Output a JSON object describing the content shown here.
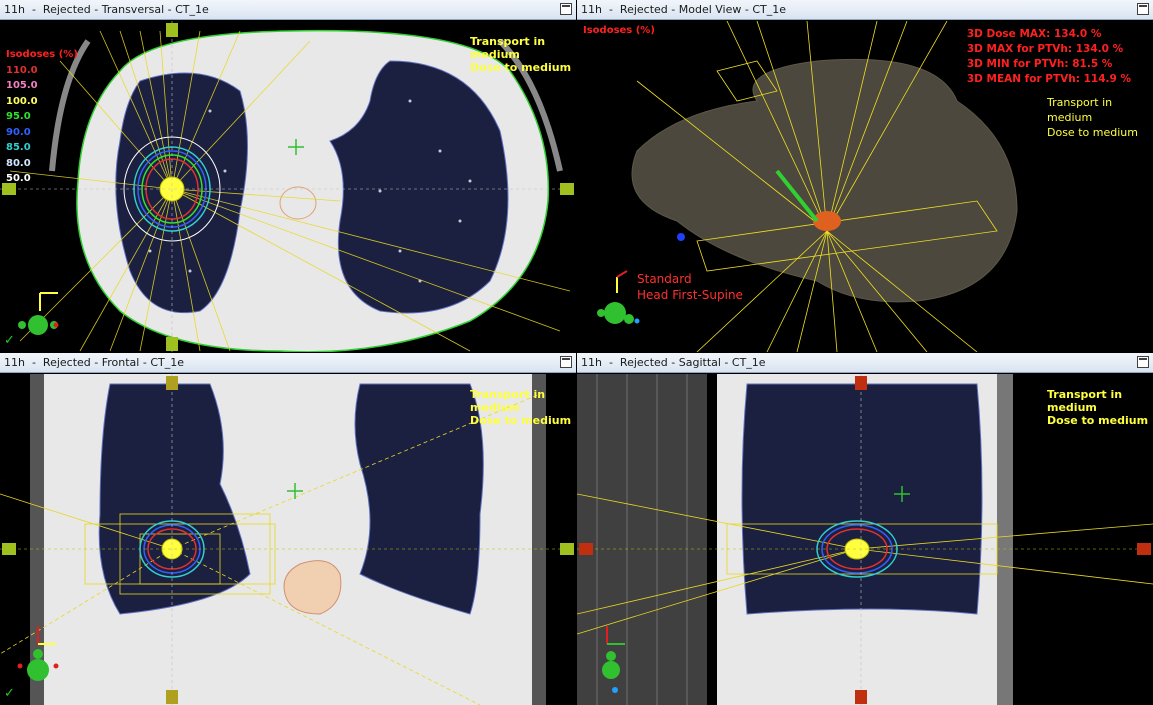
{
  "panes": {
    "transversal": {
      "title": "11h  -  Rejected - Transversal - CT_1e",
      "transport_note": [
        "Transport in",
        "medium",
        "Dose to medium"
      ]
    },
    "model": {
      "title": "11h  -  Rejected - Model View - CT_1e",
      "isodoses_title": "Isodoses (%)",
      "stats": [
        "3D Dose MAX: 134.0 %",
        "3D MAX for PTVh: 134.0 %",
        "3D MIN for PTVh: 81.5 %",
        "3D MEAN for PTVh: 114.9 %"
      ],
      "transport_note": [
        "Transport in",
        "medium",
        "Dose to medium"
      ],
      "orientation": [
        "Standard",
        "Head First-Supine"
      ]
    },
    "frontal": {
      "title": "11h  -  Rejected - Frontal - CT_1e",
      "transport_note": [
        "Transport in",
        "medium",
        "Dose to medium"
      ]
    },
    "sagittal": {
      "title": "11h  -  Rejected - Sagittal - CT_1e",
      "transport_note": [
        "Transport in",
        "medium",
        "Dose to medium"
      ]
    }
  },
  "isodoses": {
    "title": "Isodoses (%)",
    "levels": [
      {
        "value": "110.0",
        "color": "#e03030"
      },
      {
        "value": "105.0",
        "color": "#f080c0"
      },
      {
        "value": "100.0",
        "color": "#ffff60"
      },
      {
        "value": "95.0",
        "color": "#30e030"
      },
      {
        "value": "90.0",
        "color": "#3060ff"
      },
      {
        "value": "85.0",
        "color": "#30d0d0"
      },
      {
        "value": "80.0",
        "color": "#d0e8ff"
      },
      {
        "value": "50.0",
        "color": "#ffffff"
      }
    ]
  },
  "check_mark": "✓"
}
